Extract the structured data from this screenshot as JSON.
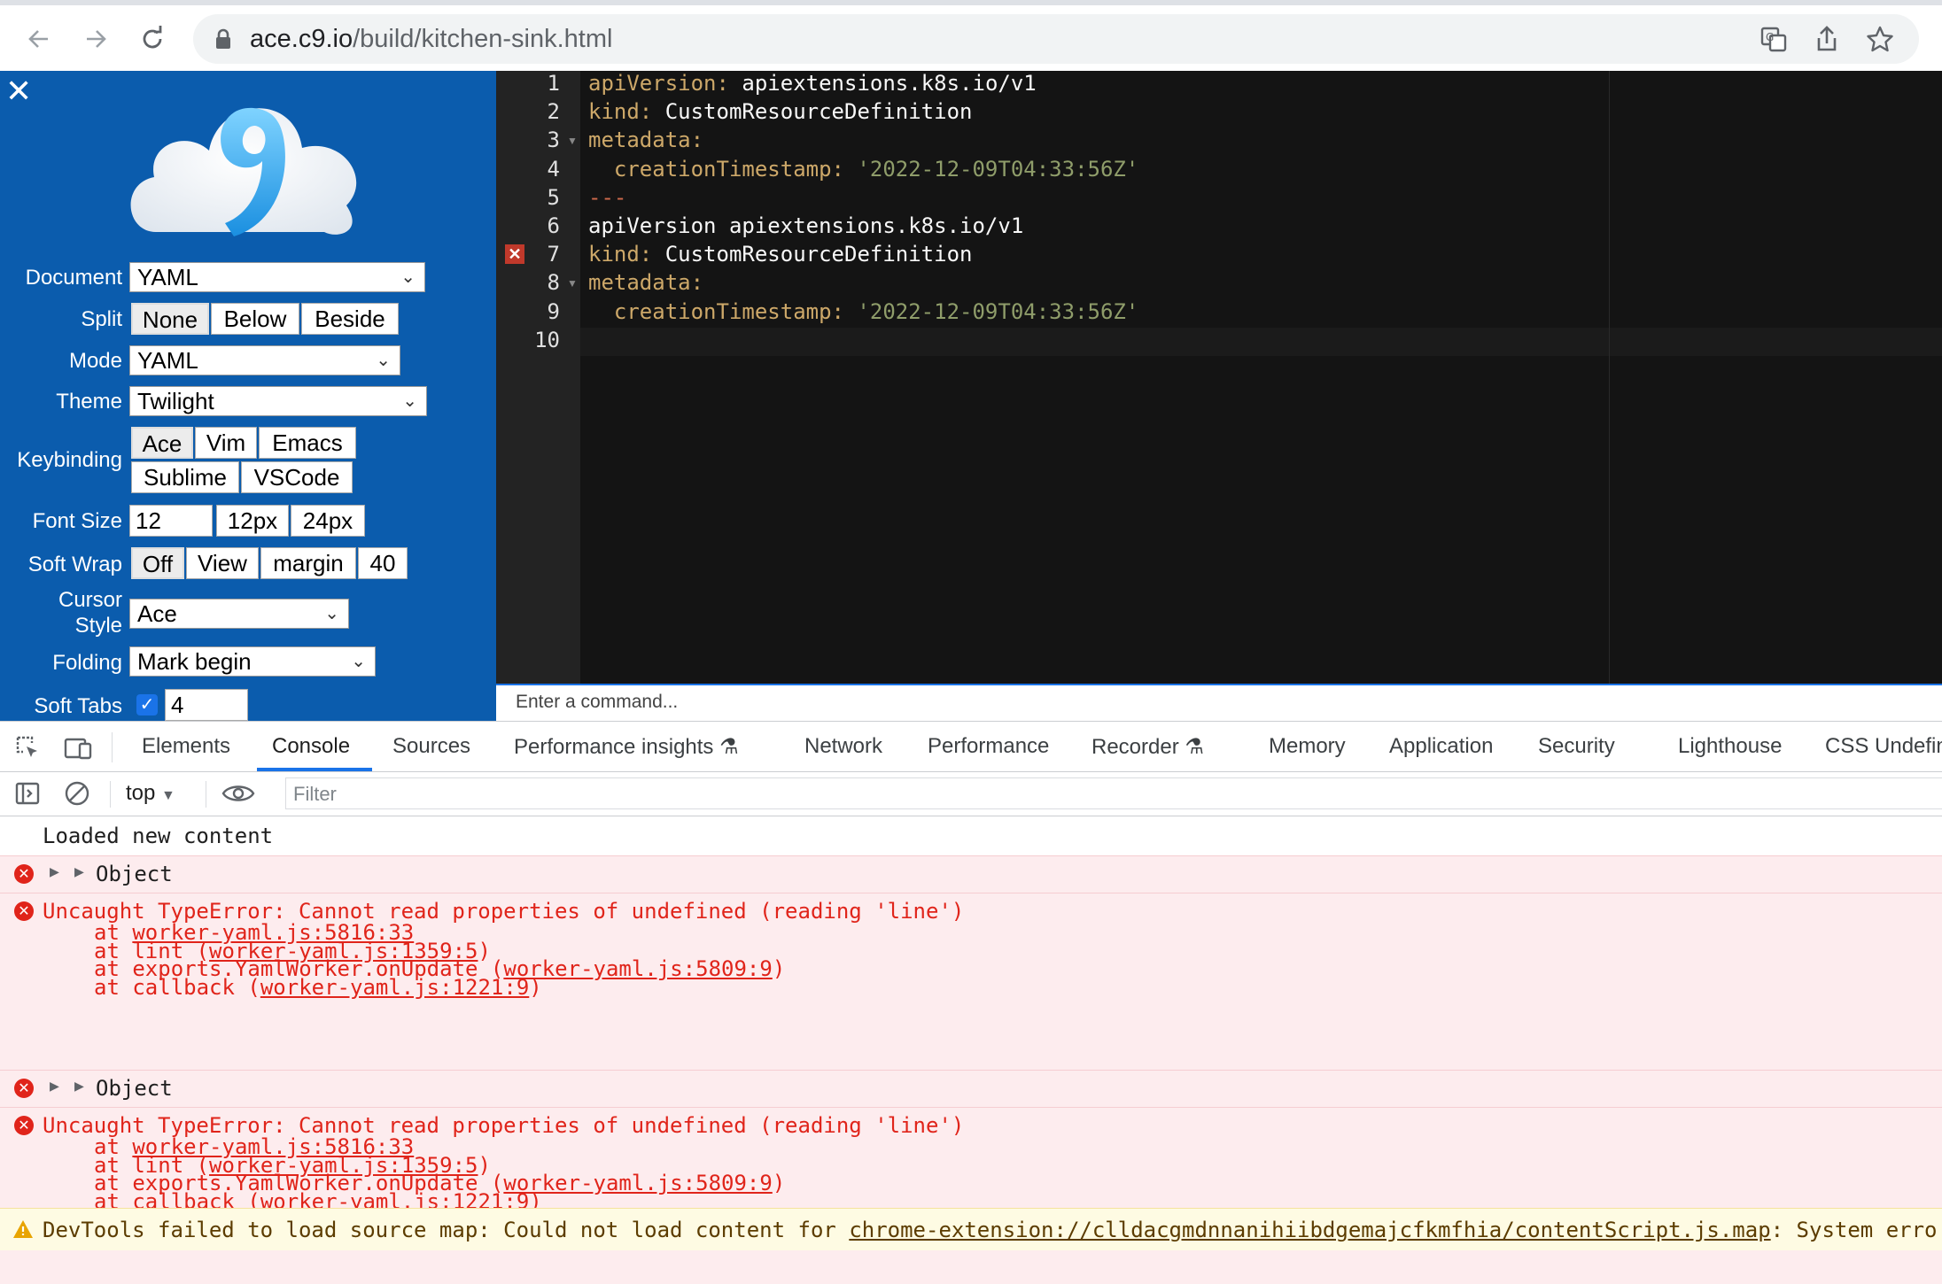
{
  "browser": {
    "url_host": "ace.c9.io",
    "url_path": "/build/kitchen-sink.html"
  },
  "panel": {
    "document_label": "Document",
    "document_value": "YAML",
    "split_label": "Split",
    "split_options": [
      "None",
      "Below",
      "Beside"
    ],
    "mode_label": "Mode",
    "mode_value": "YAML",
    "theme_label": "Theme",
    "theme_value": "Twilight",
    "keybinding_label": "Keybinding",
    "keybinding_row1": [
      "Ace",
      "Vim",
      "Emacs"
    ],
    "keybinding_row2": [
      "Sublime",
      "VSCode"
    ],
    "fontsize_label": "Font Size",
    "fontsize_value": "12",
    "fontsize_options": [
      "12px",
      "24px"
    ],
    "softwrap_label": "Soft Wrap",
    "softwrap_options": [
      "Off",
      "View",
      "margin",
      "40"
    ],
    "cursor_label_1": "Cursor",
    "cursor_label_2": "Style",
    "cursor_value": "Ace",
    "folding_label": "Folding",
    "folding_value": "Mark begin",
    "softtabs_label": "Soft Tabs",
    "softtabs_value": "4"
  },
  "editor": {
    "lines": [
      {
        "n": "1",
        "k": "apiVersion:",
        "v": " apiextensions.k8s.io/v1"
      },
      {
        "n": "2",
        "k": "kind:",
        "v": " CustomResourceDefinition"
      },
      {
        "n": "3",
        "k": "metadata:",
        "v": ""
      },
      {
        "n": "4",
        "k": "  creationTimestamp:",
        "s": " '2022-12-09T04:33:56Z'"
      },
      {
        "n": "5",
        "sep": "---"
      },
      {
        "n": "6",
        "v": "apiVersion apiextensions.k8s.io/v1"
      },
      {
        "n": "7",
        "k": "kind:",
        "v": " CustomResourceDefinition"
      },
      {
        "n": "8",
        "k": "metadata:",
        "v": ""
      },
      {
        "n": "9",
        "k": "  creationTimestamp:",
        "s": " '2022-12-09T04:33:56Z'"
      },
      {
        "n": "10",
        "v": ""
      }
    ],
    "command_placeholder": "Enter a command..."
  },
  "devtools": {
    "tabs": [
      "Elements",
      "Console",
      "Sources",
      "Performance insights",
      "Network",
      "Performance",
      "Recorder",
      "Memory",
      "Application",
      "Security",
      "Lighthouse",
      "CSS Undefin"
    ],
    "context": "top",
    "filter_placeholder": "Filter"
  },
  "console": {
    "loaded": "Loaded new content",
    "object": "Object",
    "error_msg": "Uncaught TypeError: Cannot read properties of undefined (reading 'line')",
    "stack": [
      {
        "pre": "at ",
        "fn": "",
        "link": "worker-yaml.js:5816:33",
        "post": ""
      },
      {
        "pre": "at lint (",
        "fn": "",
        "link": "worker-yaml.js:1359:5",
        "post": ")"
      },
      {
        "pre": "at exports.YamlWorker.onUpdate (",
        "fn": "",
        "link": "worker-yaml.js:5809:9",
        "post": ")"
      },
      {
        "pre": "at callback (",
        "fn": "",
        "link": "worker-yaml.js:1221:9",
        "post": ")"
      }
    ],
    "warning_pre": "DevTools failed to load source map: Could not load content for ",
    "warning_link": "chrome-extension://clldacgmdnnanihiibdgemajcfkmfhia/contentScript.js.map",
    "warning_post": ": System erro"
  }
}
